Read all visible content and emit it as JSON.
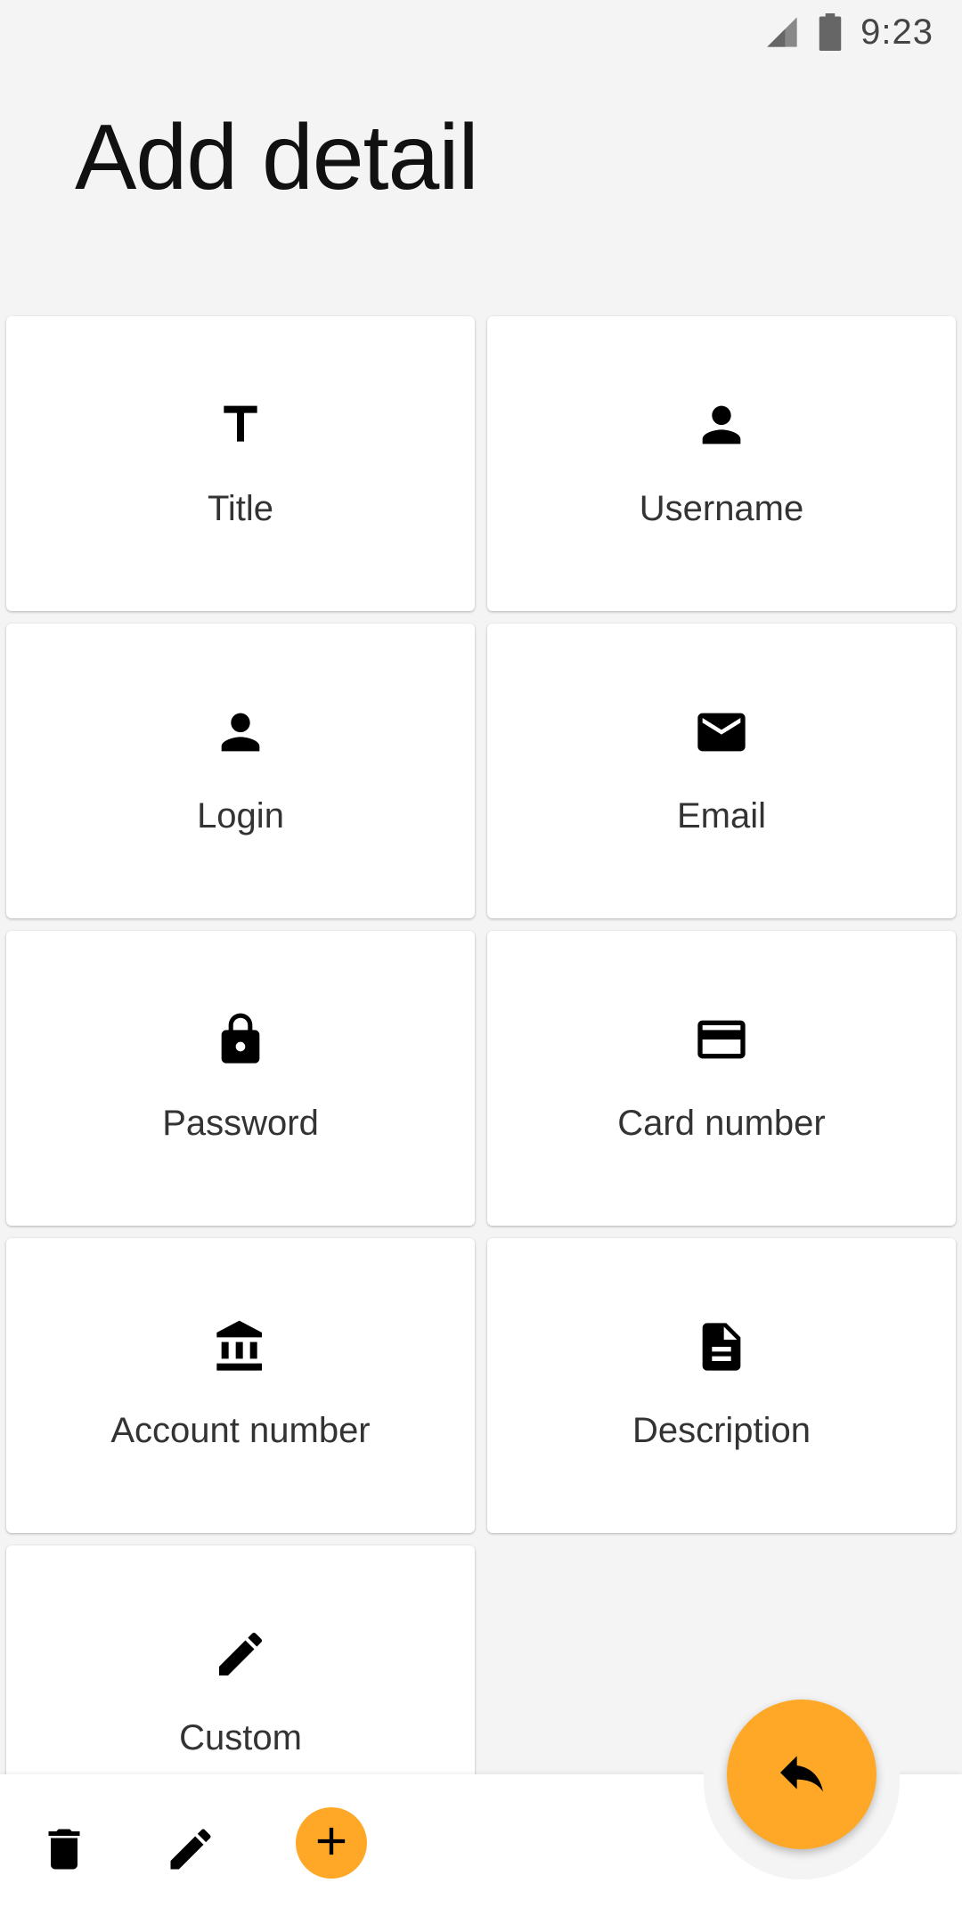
{
  "status_bar": {
    "time": "9:23",
    "signal_icon": "signal-icon",
    "battery_icon": "battery-icon"
  },
  "page": {
    "title": "Add detail"
  },
  "cards": [
    {
      "label": "Title",
      "icon": "title-text-icon"
    },
    {
      "label": "Username",
      "icon": "person-icon"
    },
    {
      "label": "Login",
      "icon": "person-icon"
    },
    {
      "label": "Email",
      "icon": "mail-icon"
    },
    {
      "label": "Password",
      "icon": "lock-icon"
    },
    {
      "label": "Card number",
      "icon": "credit-card-icon"
    },
    {
      "label": "Account number",
      "icon": "bank-icon"
    },
    {
      "label": "Description",
      "icon": "document-icon"
    },
    {
      "label": "Custom",
      "icon": "pencil-icon"
    }
  ],
  "bottom_bar": {
    "delete_icon": "trash-icon",
    "edit_icon": "pencil-icon",
    "add_icon": "plus-icon"
  },
  "fab": {
    "icon": "reply-icon"
  },
  "colors": {
    "accent": "#ffa726",
    "background": "#f4f4f4",
    "card": "#ffffff"
  }
}
